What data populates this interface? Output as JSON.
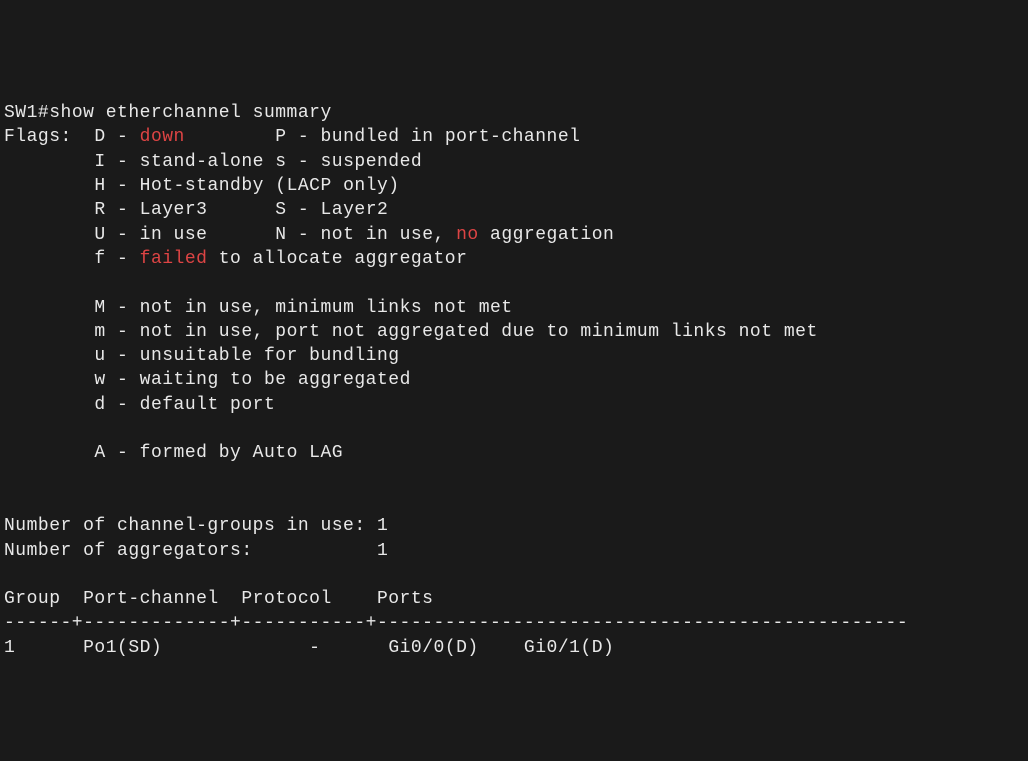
{
  "prompt": "SW1#",
  "command": "show etherchannel summary",
  "flags_label": "Flags:",
  "flags": {
    "D": {
      "code": "D",
      "sep": " - ",
      "highlight": "down"
    },
    "P": {
      "code": "P",
      "sep": " - ",
      "desc": "bundled in port-channel"
    },
    "I": {
      "code": "I",
      "sep": " - ",
      "desc": "stand-alone"
    },
    "s": {
      "code": "s",
      "sep": " - ",
      "desc": "suspended"
    },
    "H": {
      "code": "H",
      "sep": " - ",
      "desc": "Hot-standby (LACP only)"
    },
    "R": {
      "code": "R",
      "sep": " - ",
      "desc": "Layer3"
    },
    "S": {
      "code": "S",
      "sep": " - ",
      "desc": "Layer2"
    },
    "U": {
      "code": "U",
      "sep": " - ",
      "desc": "in use"
    },
    "N": {
      "code": "N",
      "sep": " - ",
      "desc_pre": "not in use, ",
      "highlight": "no",
      "desc_post": " aggregation"
    },
    "f": {
      "code": "f",
      "sep": " - ",
      "highlight": "failed",
      "desc_post": " to allocate aggregator"
    },
    "M": {
      "code": "M",
      "sep": " - ",
      "desc": "not in use, minimum links not met"
    },
    "m": {
      "code": "m",
      "sep": " - ",
      "desc": "not in use, port not aggregated due to minimum links not met"
    },
    "u": {
      "code": "u",
      "sep": " - ",
      "desc": "unsuitable for bundling"
    },
    "w": {
      "code": "w",
      "sep": " - ",
      "desc": "waiting to be aggregated"
    },
    "d": {
      "code": "d",
      "sep": " - ",
      "desc": "default port"
    },
    "A": {
      "code": "A",
      "sep": " - ",
      "desc": "formed by Auto LAG"
    }
  },
  "stats": {
    "channel_groups_label": "Number of channel-groups in use: ",
    "channel_groups_value": "1",
    "aggregators_label": "Number of aggregators:           ",
    "aggregators_value": "1"
  },
  "table": {
    "header": "Group  Port-channel  Protocol    Ports",
    "divider": "------+-------------+-----------+-----------------------------------------------",
    "rows": [
      {
        "group": "1",
        "port_channel": "Po1(SD)",
        "protocol": "   -",
        "ports": "Gi0/0(D)    Gi0/1(D)"
      }
    ]
  }
}
